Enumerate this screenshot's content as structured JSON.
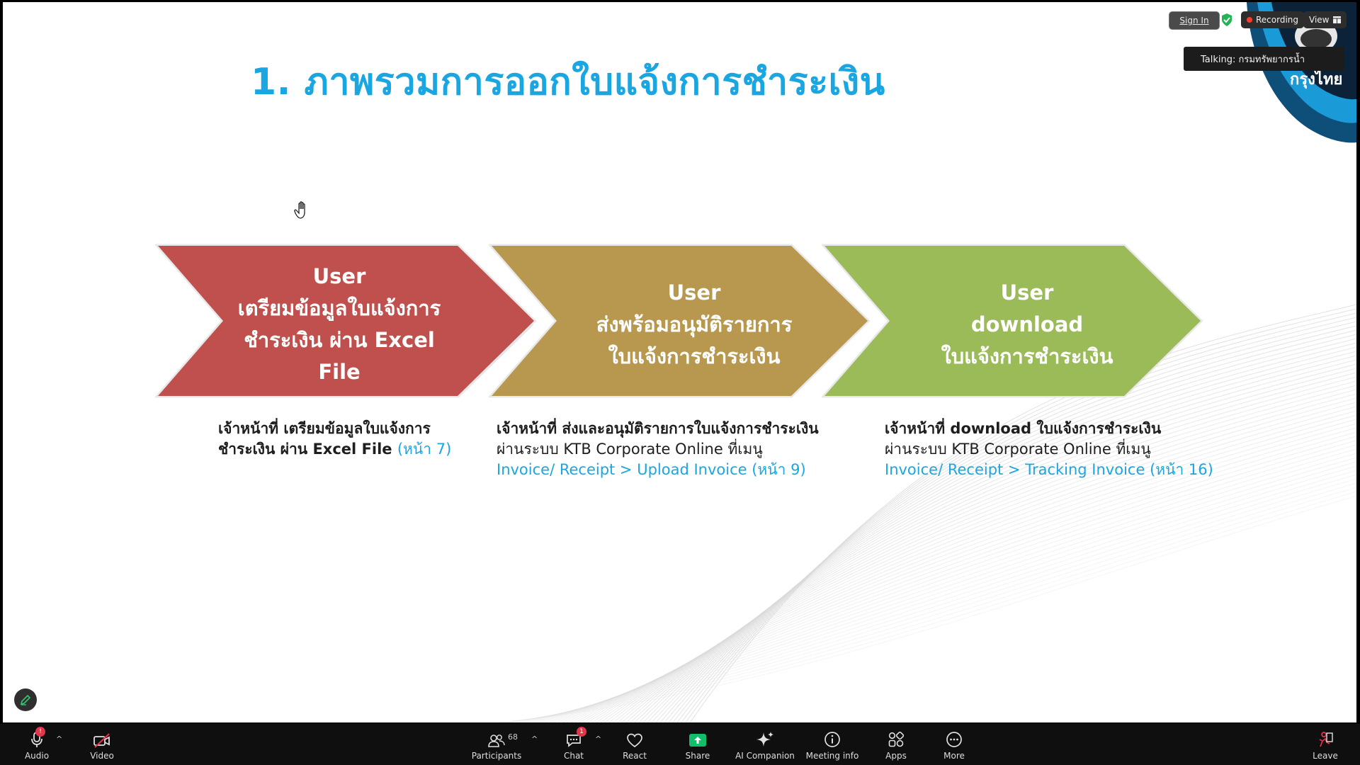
{
  "slide": {
    "title": "1. ภาพรวมการออกใบแจ้งการชำระเงิน",
    "steps": [
      {
        "lines": [
          "User",
          "เตรียมข้อมูลใบแจ้งการ",
          "ชำระเงิน ผ่าน Excel",
          "File"
        ],
        "color": "#c0504d"
      },
      {
        "lines": [
          "User",
          "ส่งพร้อมอนุมัติรายการ",
          "ใบแจ้งการชำระเงิน"
        ],
        "color": "#b8984e"
      },
      {
        "lines": [
          "User",
          "download",
          "ใบแจ้งการชำระเงิน"
        ],
        "color": "#9bbb59"
      }
    ],
    "descriptions": [
      {
        "bold_line1": "เจ้าหน้าที่ เตรียมข้อมูลใบแจ้งการ",
        "bold_line2": "ชำระเงิน ผ่าน Excel File",
        "page_ref": "(หน้า 7)"
      },
      {
        "bold_line1": "เจ้าหน้าที่  ส่งและอนุมัติรายการใบแจ้งการชำระเงิน",
        "system_text": "ผ่านระบบ KTB Corporate Online ที่เมนู",
        "menu_path": "Invoice/ Receipt > Upload Invoice (หน้า 9)"
      },
      {
        "bold_line1": "เจ้าหน้าที่  download ใบแจ้งการชำระเงิน",
        "system_text": "ผ่านระบบ KTB Corporate Online ที่เมนู",
        "menu_path": "Invoice/ Receipt > Tracking Invoice (หน้า 16)"
      }
    ],
    "logo_text": "กรุงไทย"
  },
  "overlay": {
    "sign_in": "Sign In",
    "recording": "Recording",
    "view": "View",
    "talking": "Talking: กรมทรัพยากรน้ำ"
  },
  "toolbar": {
    "audio": "Audio",
    "audio_badge": "!",
    "video": "Video",
    "participants": "Participants",
    "participants_count": "68",
    "chat": "Chat",
    "chat_badge": "1",
    "react": "React",
    "share": "Share",
    "ai_companion": "AI Companion",
    "meeting_info": "Meeting info",
    "apps": "Apps",
    "more": "More",
    "leave": "Leave"
  },
  "icons": {
    "audio": "microphone-icon",
    "video": "video-off-icon",
    "participants": "people-icon",
    "chat": "chat-bubble-icon",
    "react": "heart-icon",
    "share": "share-screen-icon",
    "ai": "sparkle-icon",
    "info": "info-icon",
    "apps": "apps-icon",
    "more": "more-icon",
    "leave": "leave-icon"
  },
  "colors": {
    "title_blue": "#1aa7e1",
    "share_green": "#0fbf6a",
    "badge_red": "#e0364a"
  }
}
